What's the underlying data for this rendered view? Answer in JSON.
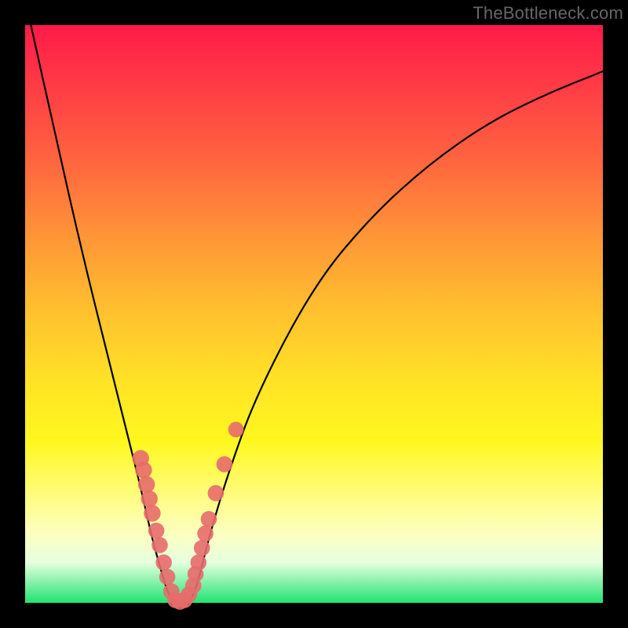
{
  "watermark": "TheBottleneck.com",
  "chart_data": {
    "type": "line",
    "title": "",
    "xlabel": "",
    "ylabel": "",
    "xlim": [
      0,
      100
    ],
    "ylim": [
      0,
      100
    ],
    "grid": false,
    "legend": false,
    "series": [
      {
        "name": "curve",
        "x": [
          1,
          5,
          10,
          15,
          18,
          20,
          22,
          24,
          25,
          26,
          27,
          28,
          29,
          30,
          32,
          35,
          40,
          50,
          60,
          70,
          80,
          90,
          100
        ],
        "y": [
          100,
          82,
          60,
          40,
          28,
          20,
          11,
          4,
          1,
          0,
          0,
          0,
          1,
          4,
          12,
          22,
          36,
          55,
          67,
          76,
          83,
          88,
          92
        ]
      }
    ],
    "markers": {
      "name": "highlight-points",
      "color": "#e76b6b",
      "points": [
        {
          "x": 20.0,
          "y": 25.0,
          "r": 1.3
        },
        {
          "x": 20.5,
          "y": 23.0,
          "r": 1.3
        },
        {
          "x": 21.0,
          "y": 20.5,
          "r": 1.3
        },
        {
          "x": 21.5,
          "y": 18.0,
          "r": 1.3
        },
        {
          "x": 22.0,
          "y": 15.5,
          "r": 1.3
        },
        {
          "x": 22.7,
          "y": 12.5,
          "r": 1.2
        },
        {
          "x": 23.3,
          "y": 10.0,
          "r": 1.2
        },
        {
          "x": 24.0,
          "y": 7.0,
          "r": 1.2
        },
        {
          "x": 24.6,
          "y": 4.5,
          "r": 1.2
        },
        {
          "x": 25.3,
          "y": 2.0,
          "r": 1.2
        },
        {
          "x": 26.0,
          "y": 0.5,
          "r": 1.2
        },
        {
          "x": 26.8,
          "y": 0.2,
          "r": 1.2
        },
        {
          "x": 27.6,
          "y": 0.5,
          "r": 1.2
        },
        {
          "x": 28.4,
          "y": 1.5,
          "r": 1.2
        },
        {
          "x": 29.1,
          "y": 3.0,
          "r": 1.2
        },
        {
          "x": 29.5,
          "y": 5.0,
          "r": 1.2
        },
        {
          "x": 30.0,
          "y": 7.0,
          "r": 1.2
        },
        {
          "x": 30.6,
          "y": 9.5,
          "r": 1.2
        },
        {
          "x": 31.2,
          "y": 12.0,
          "r": 1.2
        },
        {
          "x": 31.8,
          "y": 14.5,
          "r": 1.2
        },
        {
          "x": 33.0,
          "y": 19.0,
          "r": 1.2
        },
        {
          "x": 34.5,
          "y": 24.0,
          "r": 1.2
        },
        {
          "x": 36.5,
          "y": 30.0,
          "r": 1.1
        }
      ]
    }
  }
}
